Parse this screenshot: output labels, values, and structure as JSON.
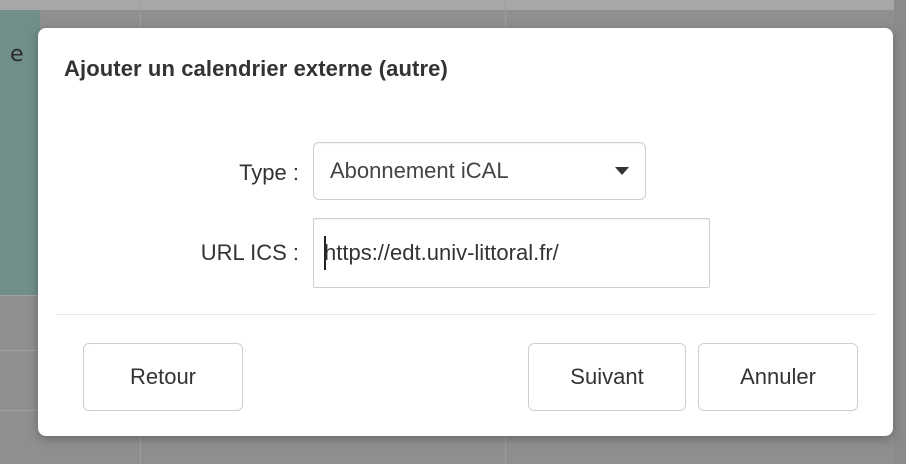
{
  "background": {
    "peek_text": "e"
  },
  "dialog": {
    "title": "Ajouter un calendrier externe (autre)",
    "fields": {
      "type": {
        "label": "Type :",
        "selected": "Abonnement iCAL"
      },
      "url": {
        "label": "URL ICS :",
        "value": "https://edt.univ-littoral.fr/"
      }
    },
    "buttons": {
      "back": "Retour",
      "next": "Suivant",
      "cancel": "Annuler"
    }
  },
  "colors": {
    "overlay": "#8f8f8f",
    "dialog_bg": "#ffffff",
    "text": "#333333",
    "border": "#cfcfcf"
  },
  "icons": {
    "select_caret": "caret-down-icon"
  }
}
